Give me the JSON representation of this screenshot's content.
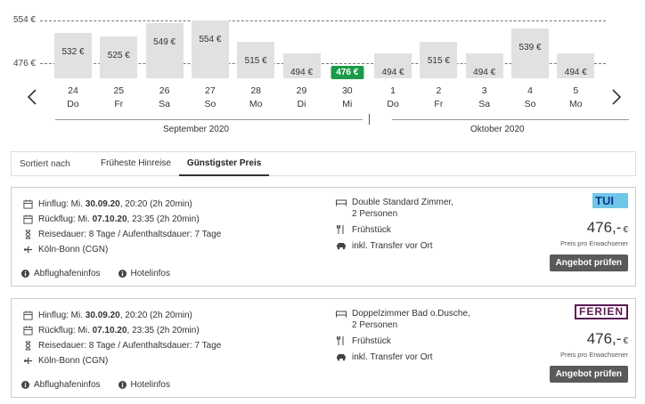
{
  "chart": {
    "ref_high": "554 €",
    "ref_low": "476 €",
    "prev_label": "previous",
    "next_label": "next",
    "months": {
      "first": "September 2020",
      "second": "Oktober 2020"
    },
    "days": [
      {
        "num": "24",
        "name": "Do",
        "price": "532 €",
        "value": 532
      },
      {
        "num": "25",
        "name": "Fr",
        "price": "525 €",
        "value": 525
      },
      {
        "num": "26",
        "name": "Sa",
        "price": "549 €",
        "value": 549
      },
      {
        "num": "27",
        "name": "So",
        "price": "554 €",
        "value": 554
      },
      {
        "num": "28",
        "name": "Mo",
        "price": "515 €",
        "value": 515
      },
      {
        "num": "29",
        "name": "Di",
        "price": "494 €",
        "value": 494
      },
      {
        "num": "30",
        "name": "Mi",
        "price": "476 €",
        "value": 476,
        "selected": true
      },
      {
        "num": "1",
        "name": "Do",
        "price": "494 €",
        "value": 494
      },
      {
        "num": "2",
        "name": "Fr",
        "price": "515 €",
        "value": 515
      },
      {
        "num": "3",
        "name": "Sa",
        "price": "494 €",
        "value": 494
      },
      {
        "num": "4",
        "name": "So",
        "price": "539 €",
        "value": 539
      },
      {
        "num": "5",
        "name": "Mo",
        "price": "494 €",
        "value": 494
      }
    ]
  },
  "sort": {
    "caption": "Sortiert nach",
    "options": [
      "Früheste Hinreise",
      "Günstigster Preis"
    ],
    "active": "Günstigster Preis"
  },
  "offers": [
    {
      "outbound_prefix": "Hinflug: Mi. ",
      "outbound_date": "30.09.20",
      "outbound_suffix": ", 20:20 (2h 20min)",
      "return_prefix": "Rückflug: Mi. ",
      "return_date": "07.10.20",
      "return_suffix": ", 23:35 (2h 20min)",
      "duration": "Reisedauer: 8 Tage / Aufenthaltsdauer: 7 Tage",
      "airport": "Köln-Bonn (CGN)",
      "room": "Double Standard Zimmer,",
      "persons": "2 Personen",
      "board": "Frühstück",
      "transfer": "inkl. Transfer vor Ort",
      "logo": "TUI",
      "price": "476,-",
      "currency": "€",
      "price_note": "Preis pro Erwachsener",
      "cta": "Angebot prüfen",
      "link_airport": "Abflughafeninfos",
      "link_hotel": "Hotelinfos"
    },
    {
      "outbound_prefix": "Hinflug: Mi. ",
      "outbound_date": "30.09.20",
      "outbound_suffix": ", 20:20 (2h 20min)",
      "return_prefix": "Rückflug: Mi. ",
      "return_date": "07.10.20",
      "return_suffix": ", 23:35 (2h 20min)",
      "duration": "Reisedauer: 8 Tage / Aufenthaltsdauer: 7 Tage",
      "airport": "Köln-Bonn (CGN)",
      "room": "Doppelzimmer Bad o.Dusche,",
      "persons": "2 Personen",
      "board": "Frühstück",
      "transfer": "inkl. Transfer vor Ort",
      "logo": "FERIEN",
      "price": "476,-",
      "currency": "€",
      "price_note": "Preis pro Erwachsener",
      "cta": "Angebot prüfen",
      "link_airport": "Abflughafeninfos",
      "link_hotel": "Hotelinfos"
    }
  ],
  "colors": {
    "selected": "#1b9b47",
    "bar": "#e1e1e1",
    "cta": "#5a5a5a",
    "tui": "#70c6e8",
    "ferien": "#5b1a55"
  }
}
